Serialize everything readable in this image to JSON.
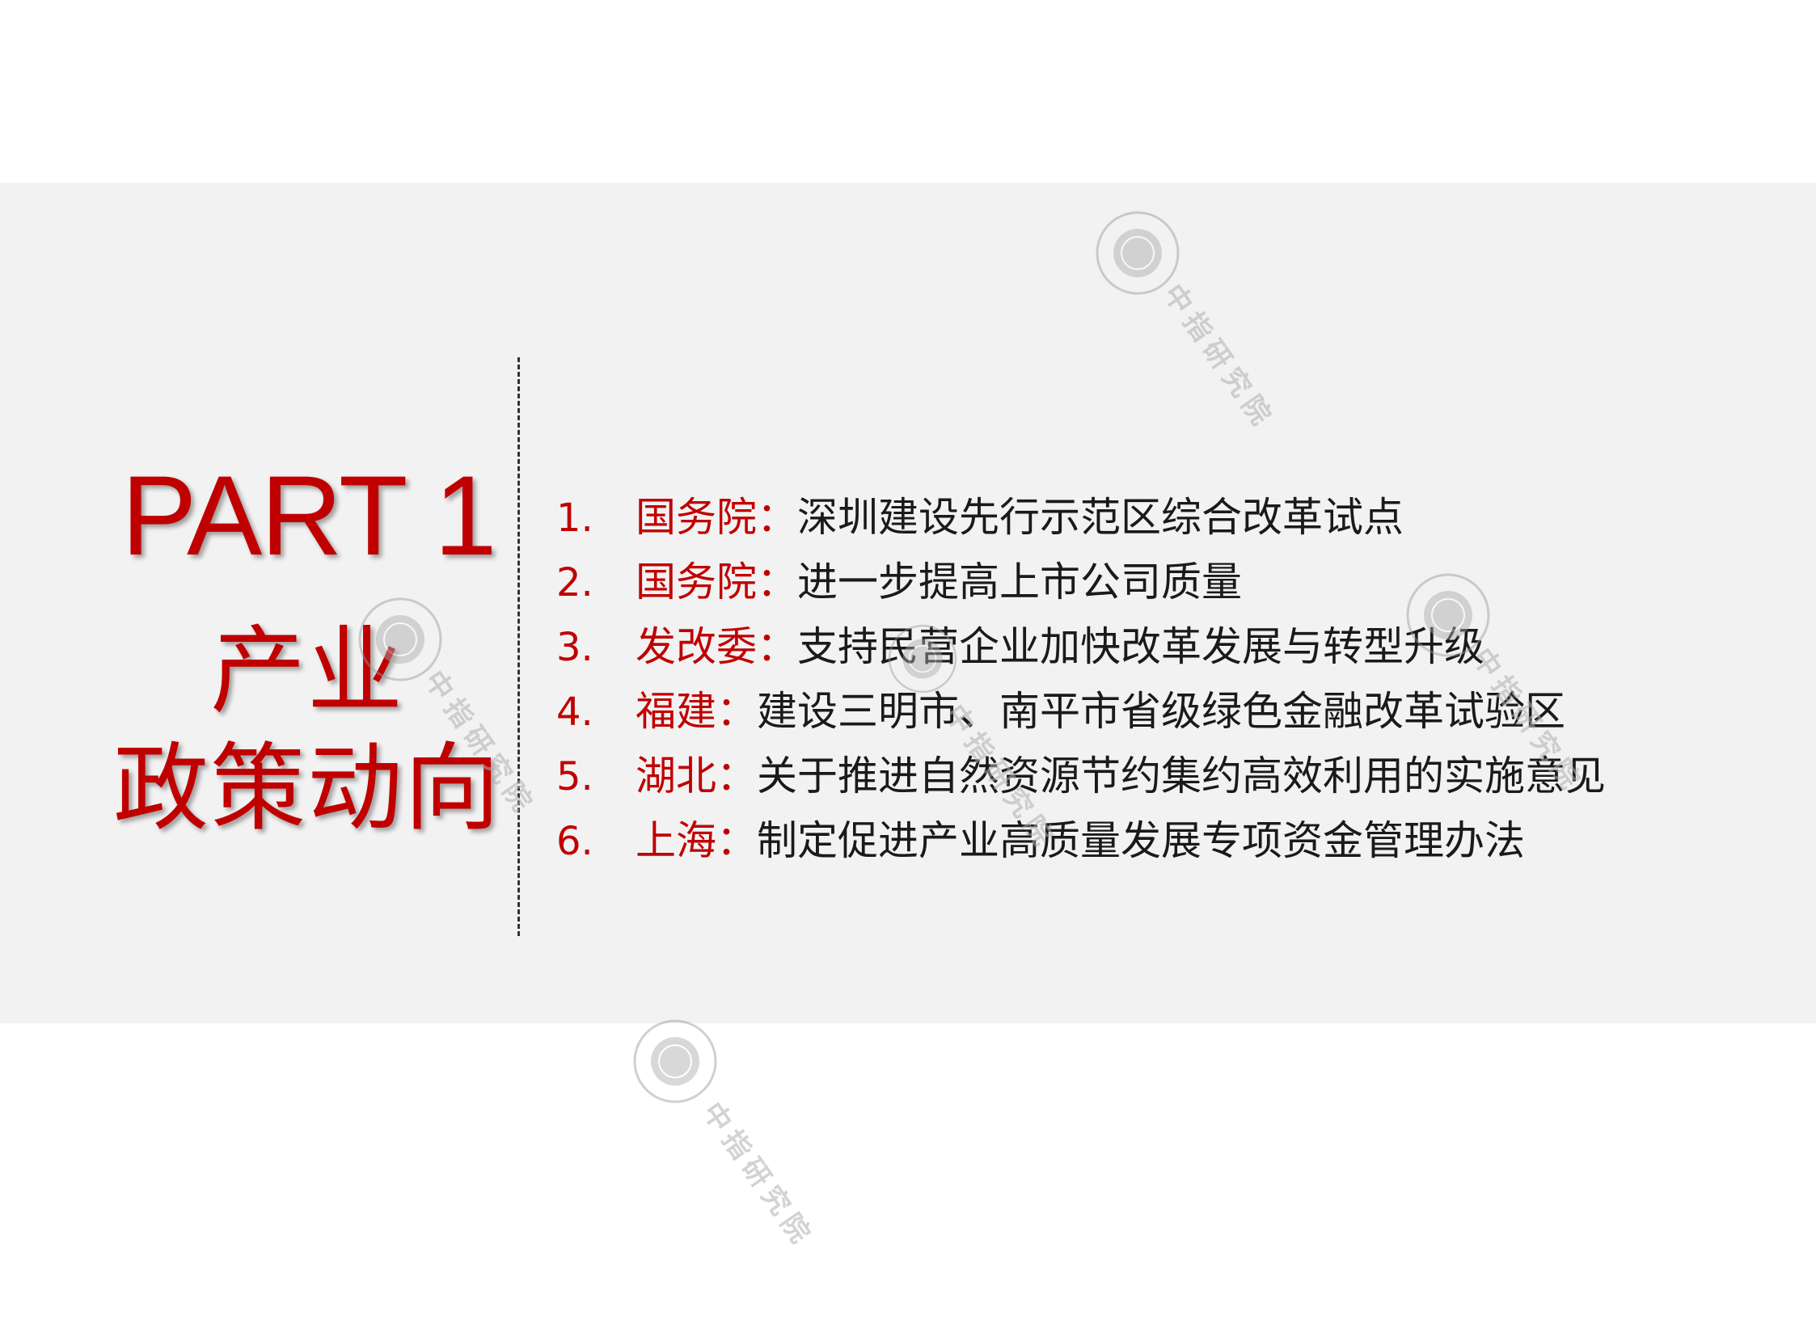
{
  "slide": {
    "part_label": "PART 1",
    "section_title_line1": "产业",
    "section_title_line2": "政策动向"
  },
  "policies": [
    {
      "num": "1.",
      "source": "国务院",
      "sep": "：",
      "text": "深圳建设先行示范区综合改革试点"
    },
    {
      "num": "2.",
      "source": "国务院",
      "sep": "：",
      "text": "进一步提高上市公司质量"
    },
    {
      "num": "3.",
      "source": "发改委",
      "sep": "：",
      "text": "支持民营企业加快改革发展与转型升级"
    },
    {
      "num": "4.",
      "source": "福建",
      "sep": "：",
      "text": "建设三明市、南平市省级绿色金融改革试验区"
    },
    {
      "num": "5.",
      "source": "湖北",
      "sep": "：",
      "text": "关于推进自然资源节约集约高效利用的实施意见"
    },
    {
      "num": "6.",
      "source": "上海",
      "sep": "：",
      "text": "制定促进产业高质量发展专项资金管理办法"
    }
  ],
  "watermark": {
    "text": "中指研究院",
    "seal_icon": "seal-icon",
    "color": "#b0b0b0"
  },
  "colors": {
    "accent": "#c00000",
    "band": "#f2f2f2",
    "text": "#1a1a1a"
  }
}
